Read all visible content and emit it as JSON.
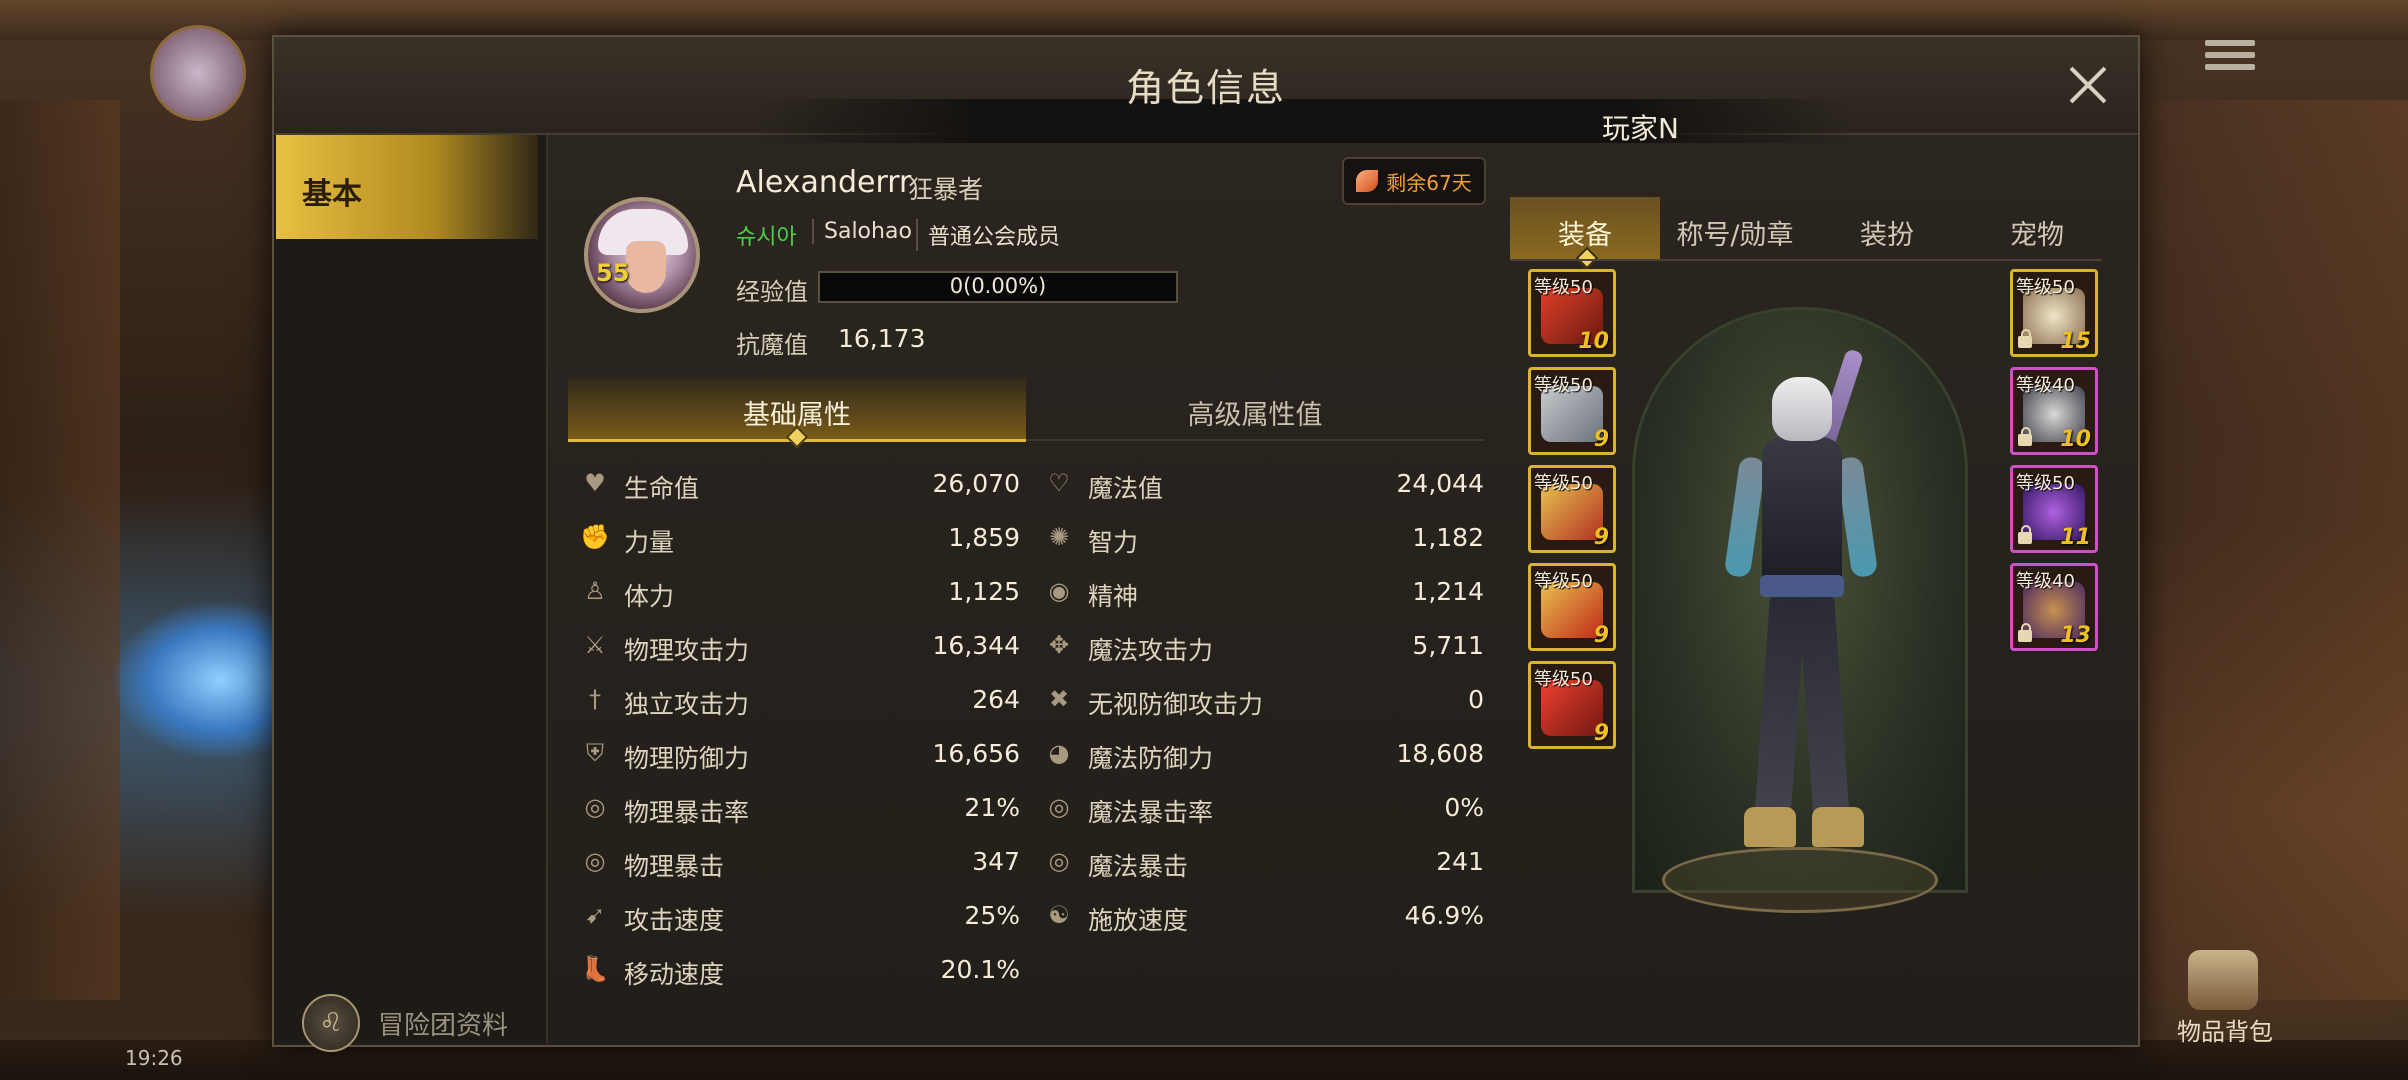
{
  "window": {
    "title": "角色信息",
    "player_name": "玩家N"
  },
  "sidebar": {
    "basic_label": "基本",
    "adventure_profile_label": "冒险团资料"
  },
  "character": {
    "level": "55",
    "name": "Alexanderrr",
    "class": "狂暴者",
    "server": "슈시아",
    "guild": "Salohao",
    "guild_rank": "普通公会成员",
    "exp_label": "经验值",
    "exp_text": "0(0.00%)",
    "exp_progress": 0.0,
    "resist_label": "抗魔值",
    "resist_value": "16,173",
    "remaining": "剩余67天"
  },
  "attr_tabs": {
    "basic": "基础属性",
    "advanced": "高级属性值"
  },
  "stats_left": [
    {
      "icon": "heart-icon",
      "label": "生命值",
      "value": "26,070"
    },
    {
      "icon": "strength-arm-icon",
      "label": "力量",
      "value": "1,859"
    },
    {
      "icon": "vitality-body-icon",
      "label": "体力",
      "value": "1,125"
    },
    {
      "icon": "sword-icon",
      "label": "物理攻击力",
      "value": "16,344"
    },
    {
      "icon": "independent-attack-icon",
      "label": "独立攻击力",
      "value": "264"
    },
    {
      "icon": "shield-icon",
      "label": "物理防御力",
      "value": "16,656"
    },
    {
      "icon": "crit-target-icon",
      "label": "物理暴击率",
      "value": "21%"
    },
    {
      "icon": "crit-target-icon",
      "label": "物理暴击",
      "value": "347"
    },
    {
      "icon": "attack-speed-icon",
      "label": "攻击速度",
      "value": "25%"
    },
    {
      "icon": "boot-icon",
      "label": "移动速度",
      "value": "20.1%"
    }
  ],
  "stats_right": [
    {
      "icon": "mana-heart-icon",
      "label": "魔法值",
      "value": "24,044"
    },
    {
      "icon": "intelligence-icon",
      "label": "智力",
      "value": "1,182"
    },
    {
      "icon": "spirit-eye-icon",
      "label": "精神",
      "value": "1,214"
    },
    {
      "icon": "magic-attack-icon",
      "label": "魔法攻击力",
      "value": "5,711"
    },
    {
      "icon": "ignore-defense-icon",
      "label": "无视防御攻击力",
      "value": "0"
    },
    {
      "icon": "magic-defense-icon",
      "label": "魔法防御力",
      "value": "18,608"
    },
    {
      "icon": "crit-target-icon",
      "label": "魔法暴击率",
      "value": "0%"
    },
    {
      "icon": "crit-target-icon",
      "label": "魔法暴击",
      "value": "241"
    },
    {
      "icon": "cast-speed-icon",
      "label": "施放速度",
      "value": "46.9%"
    }
  ],
  "equip_tabs": {
    "equipment": "装备",
    "title_medal": "称号/勋章",
    "costume": "装扮",
    "pet": "宠物"
  },
  "equipment_left": [
    {
      "level": "等级50",
      "enhance": "10",
      "icon": "weapon-claw-icon"
    },
    {
      "level": "等级50",
      "enhance": "9",
      "icon": "chest-armor-icon"
    },
    {
      "level": "等级50",
      "enhance": "9",
      "icon": "leg-armor-icon"
    },
    {
      "level": "等级50",
      "enhance": "9",
      "icon": "belt-icon"
    },
    {
      "level": "等级50",
      "enhance": "9",
      "icon": "boots-icon"
    }
  ],
  "equipment_right": [
    {
      "level": "等级50",
      "enhance": "15",
      "icon": "bracelet-icon"
    },
    {
      "level": "等级40",
      "enhance": "10",
      "icon": "necklace-icon"
    },
    {
      "level": "等级50",
      "enhance": "11",
      "icon": "ring-icon"
    },
    {
      "level": "等级40",
      "enhance": "13",
      "icon": "subweapon-icon"
    }
  ],
  "background": {
    "clock": "19:26",
    "bag_label": "物品背包"
  },
  "colors": {
    "accent_gold": "#e0b840",
    "server_green": "#4ad048",
    "remaining_orange": "#f0a030",
    "enhance_gold": "#f0c020"
  }
}
